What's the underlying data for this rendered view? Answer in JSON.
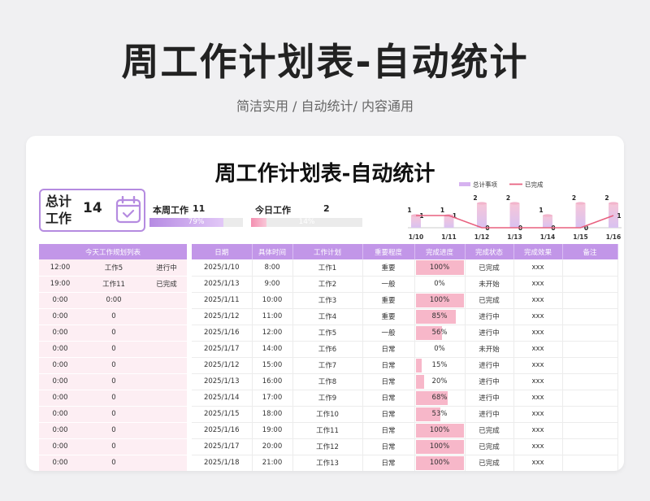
{
  "hero": {
    "title": "周工作计划表-自动统计",
    "subtitle": "简洁实用 / 自动统计/ 内容通用"
  },
  "sheet": {
    "title": "周工作计划表-自动统计",
    "total_label": "总计工作",
    "total_value": "14",
    "week_label": "本周工作",
    "week_value": "11",
    "week_pct": 0.79,
    "week_pct_text": "79%",
    "today_label": "今日工作",
    "today_value": "2",
    "today_pct": 0.14,
    "today_pct_text": "14%"
  },
  "colors": {
    "accent": "#c296e8",
    "progress": "#f7b7c9",
    "line": "#e8607f",
    "left_bg": "#fdeef3"
  },
  "chart_data": {
    "type": "bar",
    "categories": [
      "1/10",
      "1/11",
      "1/12",
      "1/13",
      "1/14",
      "1/15",
      "1/16"
    ],
    "series": [
      {
        "name": "总计事项",
        "type": "bar",
        "values": [
          1,
          1,
          2,
          2,
          1,
          2,
          2
        ]
      },
      {
        "name": "已完成",
        "type": "line",
        "values": [
          1,
          1,
          0,
          0,
          0,
          0,
          1
        ]
      }
    ],
    "legend": "top-right"
  },
  "today_table": {
    "header": "今天工作规划列表",
    "rows": [
      [
        "12:00",
        "工作5",
        "进行中"
      ],
      [
        "19:00",
        "工作11",
        "已完成"
      ],
      [
        "0:00",
        "0:00",
        ""
      ],
      [
        "0:00",
        "0",
        ""
      ],
      [
        "0:00",
        "0",
        ""
      ],
      [
        "0:00",
        "0",
        ""
      ],
      [
        "0:00",
        "0",
        ""
      ],
      [
        "0:00",
        "0",
        ""
      ],
      [
        "0:00",
        "0",
        ""
      ],
      [
        "0:00",
        "0",
        ""
      ],
      [
        "0:00",
        "0",
        ""
      ],
      [
        "0:00",
        "0",
        ""
      ],
      [
        "0:00",
        "0",
        ""
      ]
    ]
  },
  "plan_table": {
    "headers": [
      "日期",
      "具体时间",
      "工作计划",
      "重要程度",
      "完成进度",
      "完成状态",
      "完成效果",
      "备注"
    ],
    "rows": [
      {
        "date": "2025/1/10",
        "time": "8:00",
        "task": "工作1",
        "importance": "重要",
        "progress": "100%",
        "status": "已完成",
        "effect": "xxx",
        "note": ""
      },
      {
        "date": "2025/1/13",
        "time": "9:00",
        "task": "工作2",
        "importance": "一般",
        "progress": "0%",
        "status": "未开始",
        "effect": "xxx",
        "note": ""
      },
      {
        "date": "2025/1/11",
        "time": "10:00",
        "task": "工作3",
        "importance": "重要",
        "progress": "100%",
        "status": "已完成",
        "effect": "xxx",
        "note": ""
      },
      {
        "date": "2025/1/12",
        "time": "11:00",
        "task": "工作4",
        "importance": "重要",
        "progress": "85%",
        "status": "进行中",
        "effect": "xxx",
        "note": ""
      },
      {
        "date": "2025/1/16",
        "time": "12:00",
        "task": "工作5",
        "importance": "一般",
        "progress": "56%",
        "status": "进行中",
        "effect": "xxx",
        "note": ""
      },
      {
        "date": "2025/1/17",
        "time": "14:00",
        "task": "工作6",
        "importance": "日常",
        "progress": "0%",
        "status": "未开始",
        "effect": "xxx",
        "note": ""
      },
      {
        "date": "2025/1/12",
        "time": "15:00",
        "task": "工作7",
        "importance": "日常",
        "progress": "15%",
        "status": "进行中",
        "effect": "xxx",
        "note": ""
      },
      {
        "date": "2025/1/13",
        "time": "16:00",
        "task": "工作8",
        "importance": "日常",
        "progress": "20%",
        "status": "进行中",
        "effect": "xxx",
        "note": ""
      },
      {
        "date": "2025/1/14",
        "time": "17:00",
        "task": "工作9",
        "importance": "日常",
        "progress": "68%",
        "status": "进行中",
        "effect": "xxx",
        "note": ""
      },
      {
        "date": "2025/1/15",
        "time": "18:00",
        "task": "工作10",
        "importance": "日常",
        "progress": "53%",
        "status": "进行中",
        "effect": "xxx",
        "note": ""
      },
      {
        "date": "2025/1/16",
        "time": "19:00",
        "task": "工作11",
        "importance": "日常",
        "progress": "100%",
        "status": "已完成",
        "effect": "xxx",
        "note": ""
      },
      {
        "date": "2025/1/17",
        "time": "20:00",
        "task": "工作12",
        "importance": "日常",
        "progress": "100%",
        "status": "已完成",
        "effect": "xxx",
        "note": ""
      },
      {
        "date": "2025/1/18",
        "time": "21:00",
        "task": "工作13",
        "importance": "日常",
        "progress": "100%",
        "status": "已完成",
        "effect": "xxx",
        "note": ""
      }
    ]
  }
}
